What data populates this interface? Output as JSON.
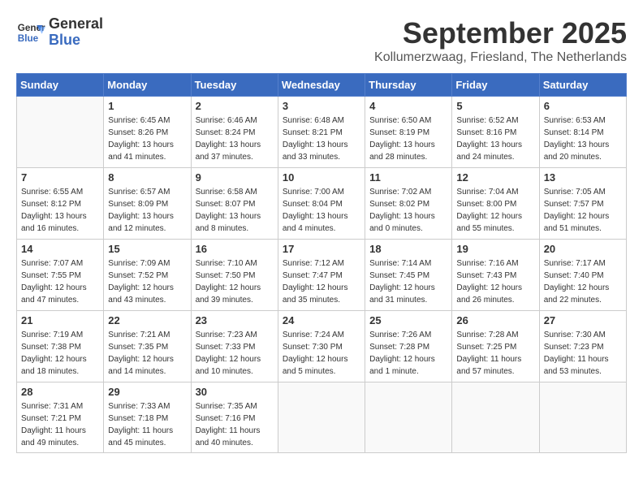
{
  "header": {
    "logo_line1": "General",
    "logo_line2": "Blue",
    "month": "September 2025",
    "location": "Kollumerzwaag, Friesland, The Netherlands"
  },
  "days_of_week": [
    "Sunday",
    "Monday",
    "Tuesday",
    "Wednesday",
    "Thursday",
    "Friday",
    "Saturday"
  ],
  "weeks": [
    [
      {
        "num": "",
        "info": ""
      },
      {
        "num": "1",
        "info": "Sunrise: 6:45 AM\nSunset: 8:26 PM\nDaylight: 13 hours\nand 41 minutes."
      },
      {
        "num": "2",
        "info": "Sunrise: 6:46 AM\nSunset: 8:24 PM\nDaylight: 13 hours\nand 37 minutes."
      },
      {
        "num": "3",
        "info": "Sunrise: 6:48 AM\nSunset: 8:21 PM\nDaylight: 13 hours\nand 33 minutes."
      },
      {
        "num": "4",
        "info": "Sunrise: 6:50 AM\nSunset: 8:19 PM\nDaylight: 13 hours\nand 28 minutes."
      },
      {
        "num": "5",
        "info": "Sunrise: 6:52 AM\nSunset: 8:16 PM\nDaylight: 13 hours\nand 24 minutes."
      },
      {
        "num": "6",
        "info": "Sunrise: 6:53 AM\nSunset: 8:14 PM\nDaylight: 13 hours\nand 20 minutes."
      }
    ],
    [
      {
        "num": "7",
        "info": "Sunrise: 6:55 AM\nSunset: 8:12 PM\nDaylight: 13 hours\nand 16 minutes."
      },
      {
        "num": "8",
        "info": "Sunrise: 6:57 AM\nSunset: 8:09 PM\nDaylight: 13 hours\nand 12 minutes."
      },
      {
        "num": "9",
        "info": "Sunrise: 6:58 AM\nSunset: 8:07 PM\nDaylight: 13 hours\nand 8 minutes."
      },
      {
        "num": "10",
        "info": "Sunrise: 7:00 AM\nSunset: 8:04 PM\nDaylight: 13 hours\nand 4 minutes."
      },
      {
        "num": "11",
        "info": "Sunrise: 7:02 AM\nSunset: 8:02 PM\nDaylight: 13 hours\nand 0 minutes."
      },
      {
        "num": "12",
        "info": "Sunrise: 7:04 AM\nSunset: 8:00 PM\nDaylight: 12 hours\nand 55 minutes."
      },
      {
        "num": "13",
        "info": "Sunrise: 7:05 AM\nSunset: 7:57 PM\nDaylight: 12 hours\nand 51 minutes."
      }
    ],
    [
      {
        "num": "14",
        "info": "Sunrise: 7:07 AM\nSunset: 7:55 PM\nDaylight: 12 hours\nand 47 minutes."
      },
      {
        "num": "15",
        "info": "Sunrise: 7:09 AM\nSunset: 7:52 PM\nDaylight: 12 hours\nand 43 minutes."
      },
      {
        "num": "16",
        "info": "Sunrise: 7:10 AM\nSunset: 7:50 PM\nDaylight: 12 hours\nand 39 minutes."
      },
      {
        "num": "17",
        "info": "Sunrise: 7:12 AM\nSunset: 7:47 PM\nDaylight: 12 hours\nand 35 minutes."
      },
      {
        "num": "18",
        "info": "Sunrise: 7:14 AM\nSunset: 7:45 PM\nDaylight: 12 hours\nand 31 minutes."
      },
      {
        "num": "19",
        "info": "Sunrise: 7:16 AM\nSunset: 7:43 PM\nDaylight: 12 hours\nand 26 minutes."
      },
      {
        "num": "20",
        "info": "Sunrise: 7:17 AM\nSunset: 7:40 PM\nDaylight: 12 hours\nand 22 minutes."
      }
    ],
    [
      {
        "num": "21",
        "info": "Sunrise: 7:19 AM\nSunset: 7:38 PM\nDaylight: 12 hours\nand 18 minutes."
      },
      {
        "num": "22",
        "info": "Sunrise: 7:21 AM\nSunset: 7:35 PM\nDaylight: 12 hours\nand 14 minutes."
      },
      {
        "num": "23",
        "info": "Sunrise: 7:23 AM\nSunset: 7:33 PM\nDaylight: 12 hours\nand 10 minutes."
      },
      {
        "num": "24",
        "info": "Sunrise: 7:24 AM\nSunset: 7:30 PM\nDaylight: 12 hours\nand 5 minutes."
      },
      {
        "num": "25",
        "info": "Sunrise: 7:26 AM\nSunset: 7:28 PM\nDaylight: 12 hours\nand 1 minute."
      },
      {
        "num": "26",
        "info": "Sunrise: 7:28 AM\nSunset: 7:25 PM\nDaylight: 11 hours\nand 57 minutes."
      },
      {
        "num": "27",
        "info": "Sunrise: 7:30 AM\nSunset: 7:23 PM\nDaylight: 11 hours\nand 53 minutes."
      }
    ],
    [
      {
        "num": "28",
        "info": "Sunrise: 7:31 AM\nSunset: 7:21 PM\nDaylight: 11 hours\nand 49 minutes."
      },
      {
        "num": "29",
        "info": "Sunrise: 7:33 AM\nSunset: 7:18 PM\nDaylight: 11 hours\nand 45 minutes."
      },
      {
        "num": "30",
        "info": "Sunrise: 7:35 AM\nSunset: 7:16 PM\nDaylight: 11 hours\nand 40 minutes."
      },
      {
        "num": "",
        "info": ""
      },
      {
        "num": "",
        "info": ""
      },
      {
        "num": "",
        "info": ""
      },
      {
        "num": "",
        "info": ""
      }
    ]
  ]
}
